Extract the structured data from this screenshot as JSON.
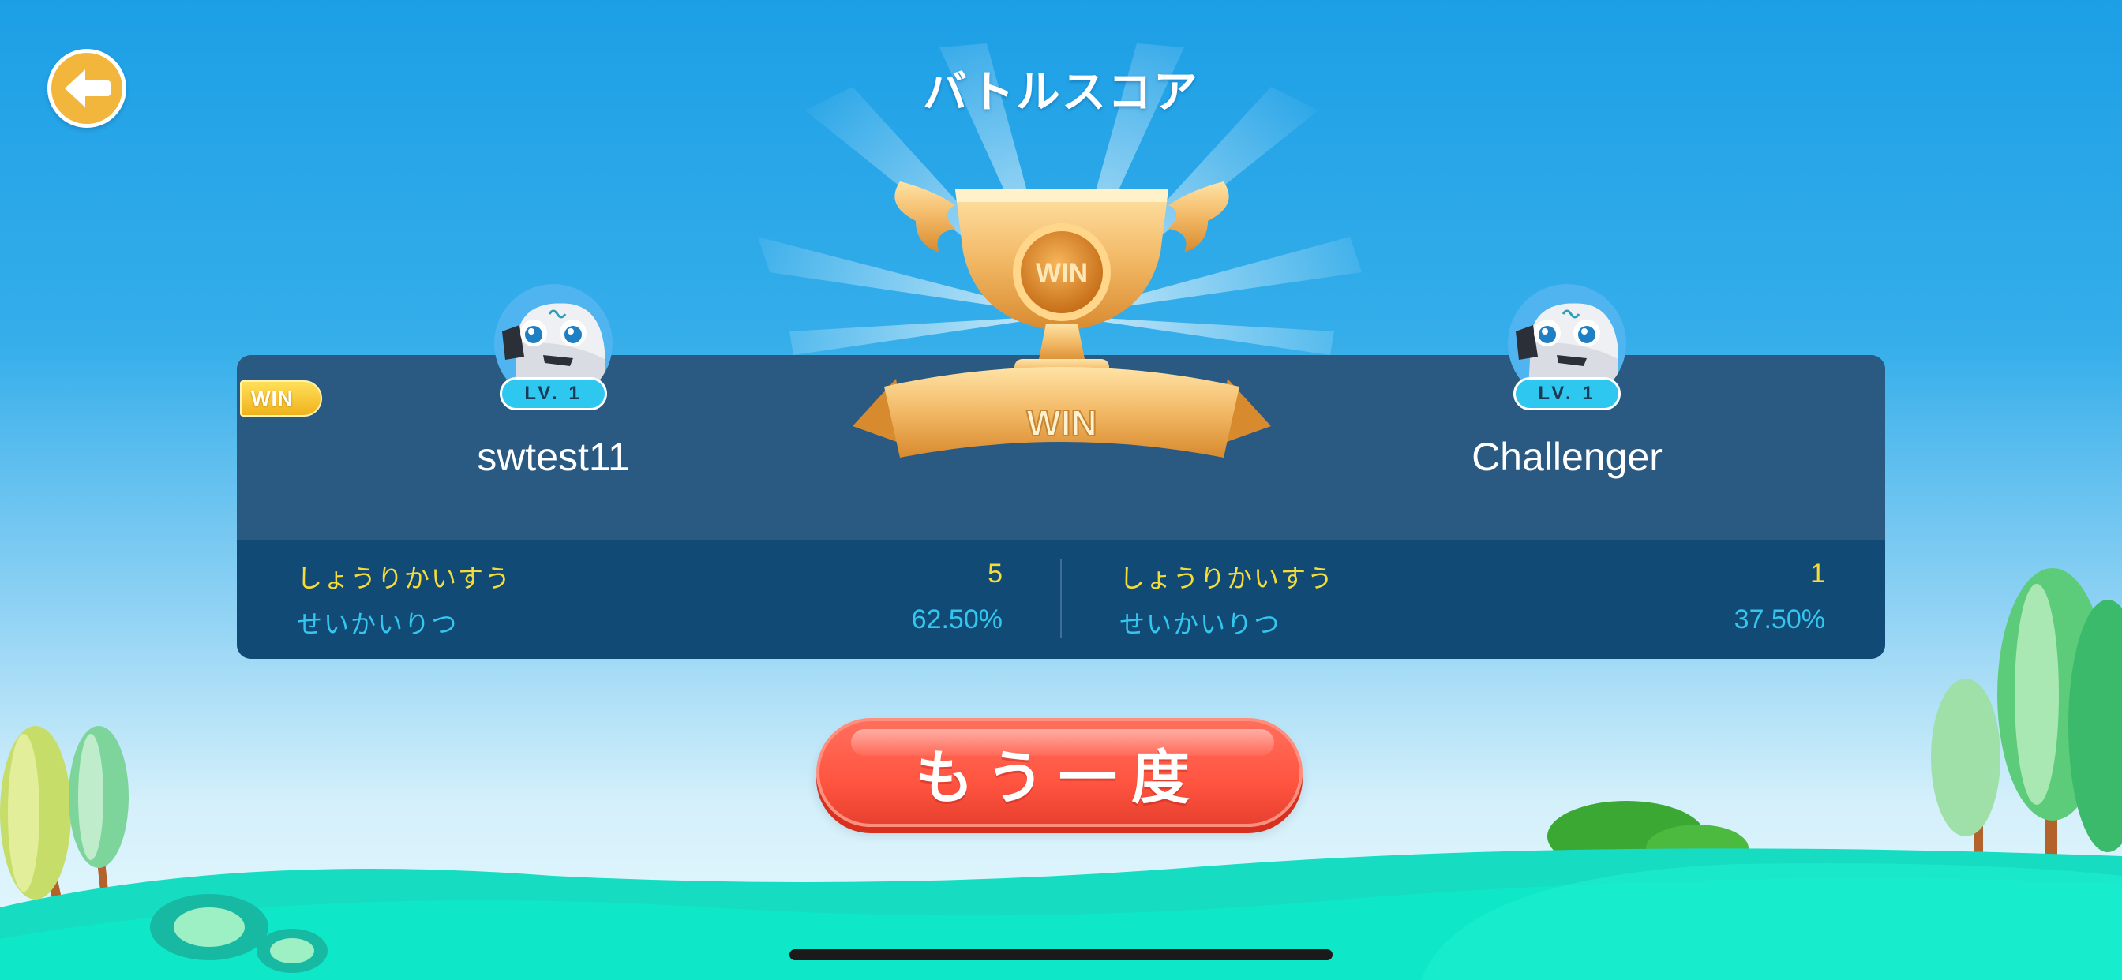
{
  "header": {
    "title": "バトルスコア",
    "back_icon": "arrow-left-icon"
  },
  "trophy": {
    "medal_text": "WIN",
    "ribbon_text": "WIN"
  },
  "players": [
    {
      "name": "swtest11",
      "level": "LV. 1",
      "win_tag": "WIN",
      "wins_label": "しょうりかいすう",
      "wins_value": "5",
      "accuracy_label": "せいかいりつ",
      "accuracy_value": "62.50%"
    },
    {
      "name": "Challenger",
      "level": "LV. 1",
      "wins_label": "しょうりかいすう",
      "wins_value": "1",
      "accuracy_label": "せいかいりつ",
      "accuracy_value": "37.50%"
    }
  ],
  "actions": {
    "again_label": "もう一度"
  },
  "colors": {
    "sky_top": "#1d9fe6",
    "panel": "#2a5a82",
    "panel_stats": "#124a76",
    "stat_yellow": "#f4dc3a",
    "stat_cyan": "#33c6ee",
    "button_red": "#ff5440",
    "back_gold": "#f2b63d",
    "grass": "#14e0c0"
  }
}
